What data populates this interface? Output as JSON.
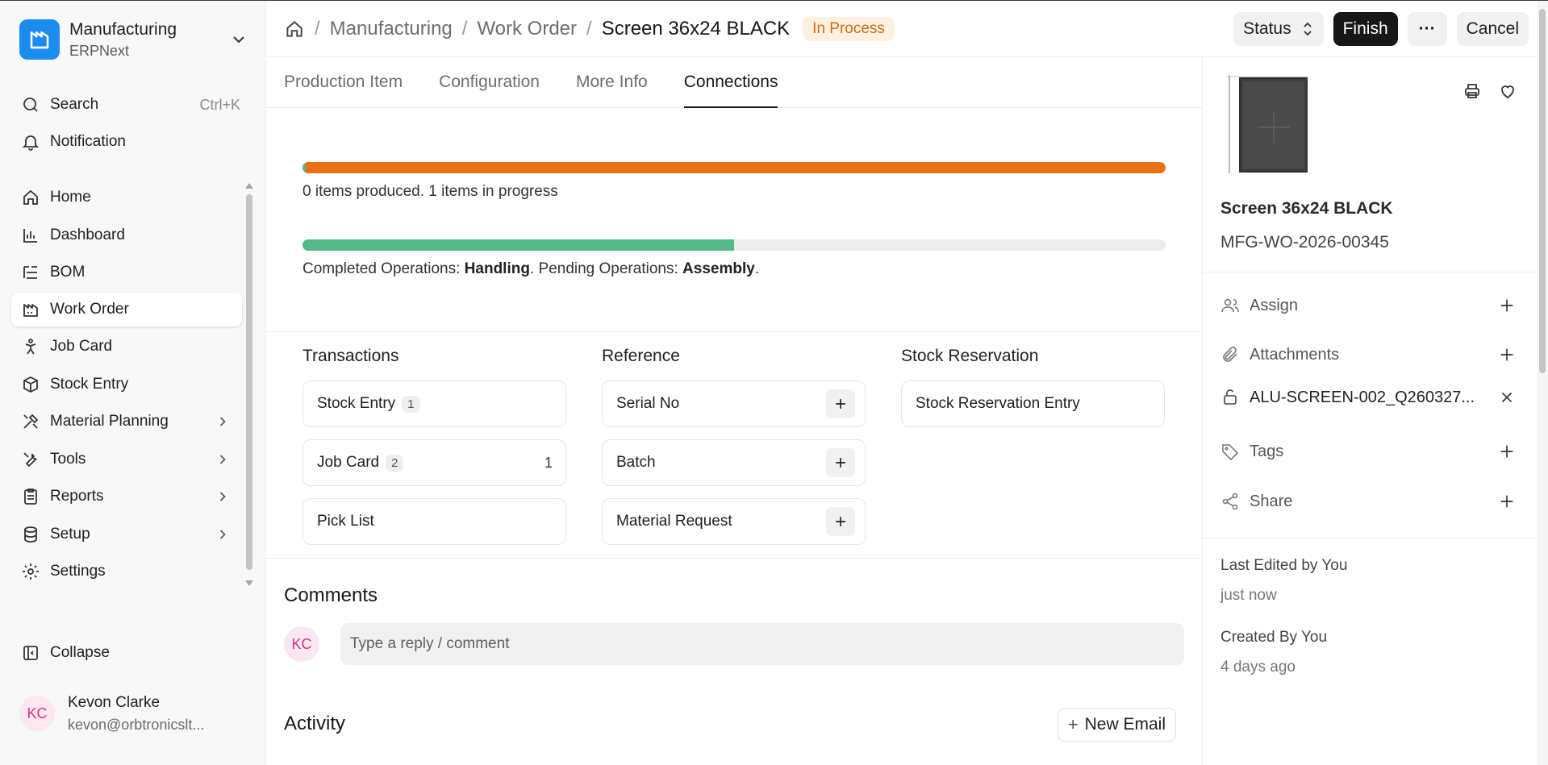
{
  "workspace": {
    "title": "Manufacturing",
    "subtitle": "ERPNext"
  },
  "sidebar": {
    "search": {
      "label": "Search",
      "shortcut": "Ctrl+K"
    },
    "notification": "Notification",
    "items": [
      {
        "label": "Home",
        "icon": "home-icon"
      },
      {
        "label": "Dashboard",
        "icon": "chart-icon"
      },
      {
        "label": "BOM",
        "icon": "list-tree-icon"
      },
      {
        "label": "Work Order",
        "icon": "factory-icon",
        "active": true
      },
      {
        "label": "Job Card",
        "icon": "person-icon"
      },
      {
        "label": "Stock Entry",
        "icon": "box-icon"
      },
      {
        "label": "Material Planning",
        "icon": "tools-icon",
        "expandable": true
      },
      {
        "label": "Tools",
        "icon": "wrench-icon",
        "expandable": true
      },
      {
        "label": "Reports",
        "icon": "clipboard-icon",
        "expandable": true
      },
      {
        "label": "Setup",
        "icon": "database-icon",
        "expandable": true
      },
      {
        "label": "Settings",
        "icon": "gear-icon"
      }
    ],
    "collapse": "Collapse",
    "user": {
      "initials": "KC",
      "name": "Kevon Clarke",
      "email": "kevon@orbtronicslt..."
    }
  },
  "breadcrumb": {
    "module": "Manufacturing",
    "doctype": "Work Order",
    "current": "Screen 36x24 BLACK",
    "status": "In Process"
  },
  "actions": {
    "status": "Status",
    "finish": "Finish",
    "more": "···",
    "cancel": "Cancel"
  },
  "tabs": [
    "Production Item",
    "Configuration",
    "More Info",
    "Connections"
  ],
  "progress": {
    "items_label": "0 items produced. 1 items in progress",
    "items_produced_fraction": 0.004,
    "items_in_progress_fraction": 0.996,
    "ops_completed_prefix": "Completed Operations: ",
    "ops_completed": "Handling",
    "ops_pending_prefix": ". Pending Operations: ",
    "ops_pending": "Assembly",
    "ops_suffix": ".",
    "ops_fraction": 0.5
  },
  "connections": {
    "transactions": {
      "title": "Transactions",
      "items": [
        {
          "label": "Stock Entry",
          "count": "1"
        },
        {
          "label": "Job Card",
          "count": "2",
          "open": "1"
        },
        {
          "label": "Pick List"
        }
      ]
    },
    "reference": {
      "title": "Reference",
      "items": [
        {
          "label": "Serial No"
        },
        {
          "label": "Batch"
        },
        {
          "label": "Material Request"
        }
      ]
    },
    "reservation": {
      "title": "Stock Reservation",
      "items": [
        {
          "label": "Stock Reservation Entry"
        }
      ]
    }
  },
  "comments": {
    "title": "Comments",
    "initials": "KC",
    "placeholder": "Type a reply / comment"
  },
  "activity": {
    "title": "Activity",
    "new_email": "New Email"
  },
  "right_panel": {
    "item_name": "Screen 36x24 BLACK",
    "doc_id": "MFG-WO-2026-00345",
    "assign": "Assign",
    "attachments": "Attachments",
    "attachment_file": "ALU-SCREEN-002_Q260327...",
    "tags": "Tags",
    "share": "Share",
    "last_edited_label": "Last Edited by You",
    "last_edited_value": "just now",
    "created_label": "Created By You",
    "created_value": "4 days ago"
  },
  "colors": {
    "accent": "#1d8cf0",
    "progress_orange": "#ea7015",
    "progress_green": "#55b886",
    "status_text": "#d26a0d",
    "status_bg": "#fff1e1"
  }
}
